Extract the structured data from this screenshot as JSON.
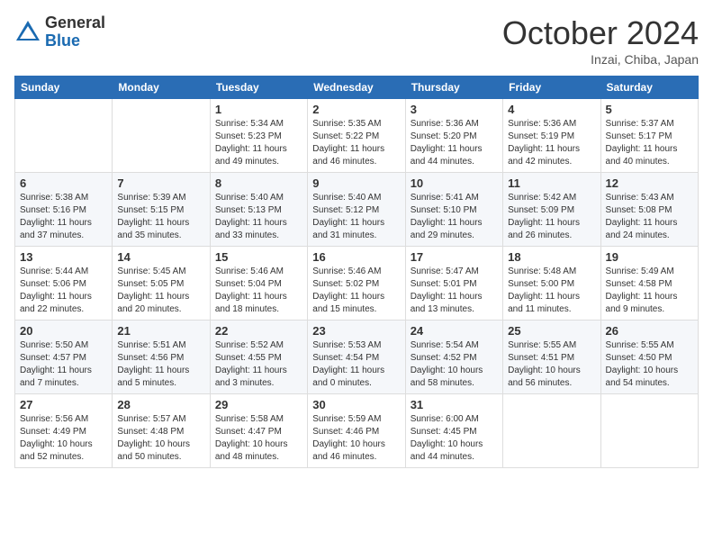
{
  "header": {
    "logo_general": "General",
    "logo_blue": "Blue",
    "month_title": "October 2024",
    "location": "Inzai, Chiba, Japan"
  },
  "weekdays": [
    "Sunday",
    "Monday",
    "Tuesday",
    "Wednesday",
    "Thursday",
    "Friday",
    "Saturday"
  ],
  "weeks": [
    [
      {
        "day": "",
        "info": ""
      },
      {
        "day": "",
        "info": ""
      },
      {
        "day": "1",
        "info": "Sunrise: 5:34 AM\nSunset: 5:23 PM\nDaylight: 11 hours and 49 minutes."
      },
      {
        "day": "2",
        "info": "Sunrise: 5:35 AM\nSunset: 5:22 PM\nDaylight: 11 hours and 46 minutes."
      },
      {
        "day": "3",
        "info": "Sunrise: 5:36 AM\nSunset: 5:20 PM\nDaylight: 11 hours and 44 minutes."
      },
      {
        "day": "4",
        "info": "Sunrise: 5:36 AM\nSunset: 5:19 PM\nDaylight: 11 hours and 42 minutes."
      },
      {
        "day": "5",
        "info": "Sunrise: 5:37 AM\nSunset: 5:17 PM\nDaylight: 11 hours and 40 minutes."
      }
    ],
    [
      {
        "day": "6",
        "info": "Sunrise: 5:38 AM\nSunset: 5:16 PM\nDaylight: 11 hours and 37 minutes."
      },
      {
        "day": "7",
        "info": "Sunrise: 5:39 AM\nSunset: 5:15 PM\nDaylight: 11 hours and 35 minutes."
      },
      {
        "day": "8",
        "info": "Sunrise: 5:40 AM\nSunset: 5:13 PM\nDaylight: 11 hours and 33 minutes."
      },
      {
        "day": "9",
        "info": "Sunrise: 5:40 AM\nSunset: 5:12 PM\nDaylight: 11 hours and 31 minutes."
      },
      {
        "day": "10",
        "info": "Sunrise: 5:41 AM\nSunset: 5:10 PM\nDaylight: 11 hours and 29 minutes."
      },
      {
        "day": "11",
        "info": "Sunrise: 5:42 AM\nSunset: 5:09 PM\nDaylight: 11 hours and 26 minutes."
      },
      {
        "day": "12",
        "info": "Sunrise: 5:43 AM\nSunset: 5:08 PM\nDaylight: 11 hours and 24 minutes."
      }
    ],
    [
      {
        "day": "13",
        "info": "Sunrise: 5:44 AM\nSunset: 5:06 PM\nDaylight: 11 hours and 22 minutes."
      },
      {
        "day": "14",
        "info": "Sunrise: 5:45 AM\nSunset: 5:05 PM\nDaylight: 11 hours and 20 minutes."
      },
      {
        "day": "15",
        "info": "Sunrise: 5:46 AM\nSunset: 5:04 PM\nDaylight: 11 hours and 18 minutes."
      },
      {
        "day": "16",
        "info": "Sunrise: 5:46 AM\nSunset: 5:02 PM\nDaylight: 11 hours and 15 minutes."
      },
      {
        "day": "17",
        "info": "Sunrise: 5:47 AM\nSunset: 5:01 PM\nDaylight: 11 hours and 13 minutes."
      },
      {
        "day": "18",
        "info": "Sunrise: 5:48 AM\nSunset: 5:00 PM\nDaylight: 11 hours and 11 minutes."
      },
      {
        "day": "19",
        "info": "Sunrise: 5:49 AM\nSunset: 4:58 PM\nDaylight: 11 hours and 9 minutes."
      }
    ],
    [
      {
        "day": "20",
        "info": "Sunrise: 5:50 AM\nSunset: 4:57 PM\nDaylight: 11 hours and 7 minutes."
      },
      {
        "day": "21",
        "info": "Sunrise: 5:51 AM\nSunset: 4:56 PM\nDaylight: 11 hours and 5 minutes."
      },
      {
        "day": "22",
        "info": "Sunrise: 5:52 AM\nSunset: 4:55 PM\nDaylight: 11 hours and 3 minutes."
      },
      {
        "day": "23",
        "info": "Sunrise: 5:53 AM\nSunset: 4:54 PM\nDaylight: 11 hours and 0 minutes."
      },
      {
        "day": "24",
        "info": "Sunrise: 5:54 AM\nSunset: 4:52 PM\nDaylight: 10 hours and 58 minutes."
      },
      {
        "day": "25",
        "info": "Sunrise: 5:55 AM\nSunset: 4:51 PM\nDaylight: 10 hours and 56 minutes."
      },
      {
        "day": "26",
        "info": "Sunrise: 5:55 AM\nSunset: 4:50 PM\nDaylight: 10 hours and 54 minutes."
      }
    ],
    [
      {
        "day": "27",
        "info": "Sunrise: 5:56 AM\nSunset: 4:49 PM\nDaylight: 10 hours and 52 minutes."
      },
      {
        "day": "28",
        "info": "Sunrise: 5:57 AM\nSunset: 4:48 PM\nDaylight: 10 hours and 50 minutes."
      },
      {
        "day": "29",
        "info": "Sunrise: 5:58 AM\nSunset: 4:47 PM\nDaylight: 10 hours and 48 minutes."
      },
      {
        "day": "30",
        "info": "Sunrise: 5:59 AM\nSunset: 4:46 PM\nDaylight: 10 hours and 46 minutes."
      },
      {
        "day": "31",
        "info": "Sunrise: 6:00 AM\nSunset: 4:45 PM\nDaylight: 10 hours and 44 minutes."
      },
      {
        "day": "",
        "info": ""
      },
      {
        "day": "",
        "info": ""
      }
    ]
  ]
}
